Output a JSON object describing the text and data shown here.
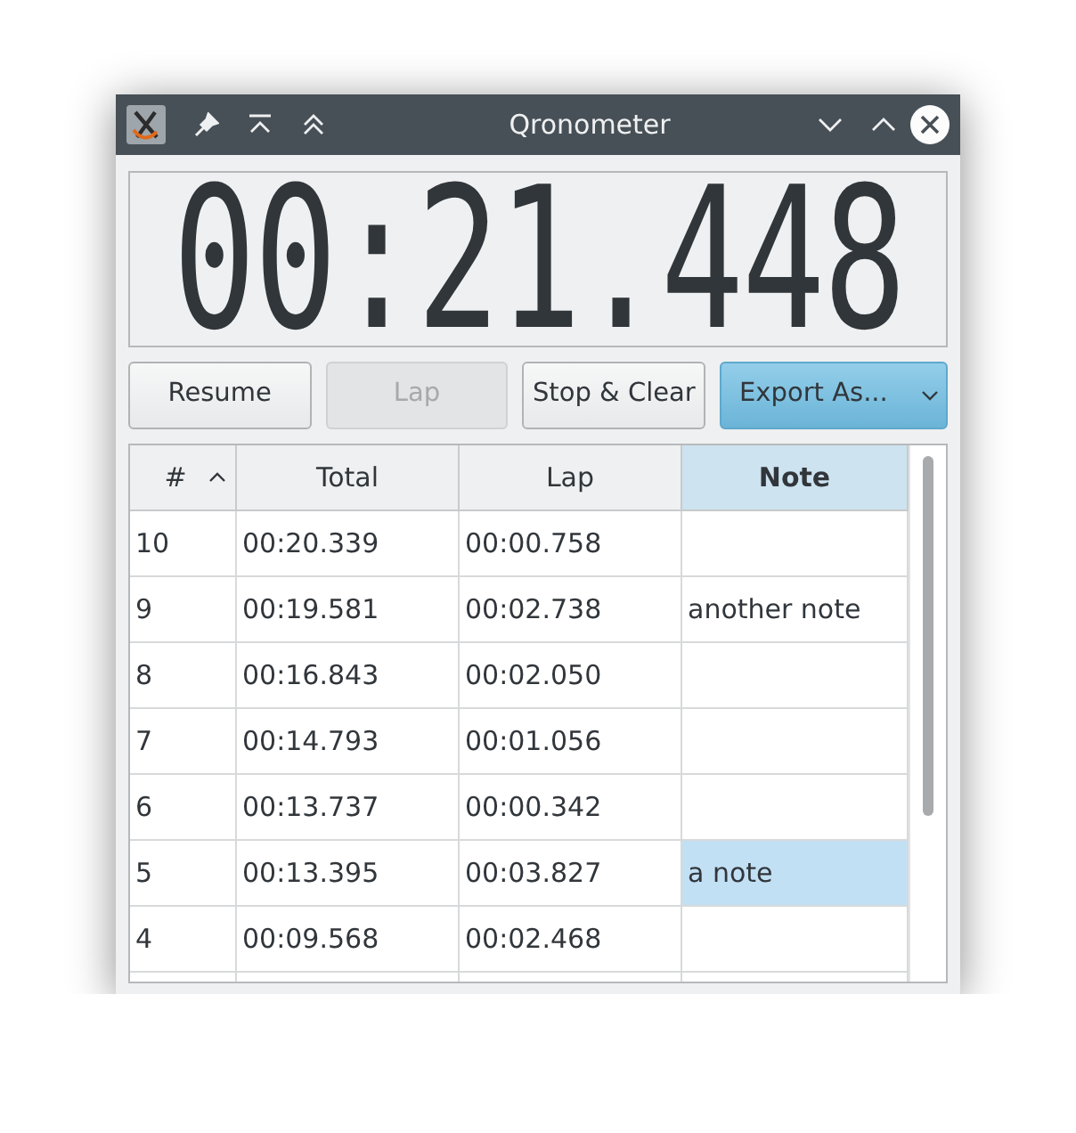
{
  "window": {
    "title": "Qronometer"
  },
  "display": {
    "time": "00:21.448"
  },
  "buttons": [
    {
      "label": "Resume",
      "disabled": false,
      "kind": "push"
    },
    {
      "label": "Lap",
      "disabled": true,
      "kind": "push"
    },
    {
      "label": "Stop & Clear",
      "disabled": false,
      "kind": "push"
    },
    {
      "label": "Export As...",
      "disabled": false,
      "kind": "menu"
    }
  ],
  "table": {
    "columns": [
      {
        "label": "#",
        "sorted_ascending": true,
        "selected": false
      },
      {
        "label": "Total",
        "selected": false
      },
      {
        "label": "Lap",
        "selected": false
      },
      {
        "label": "Note",
        "selected": true
      }
    ],
    "rows": [
      {
        "number": "10",
        "total": "00:20.339",
        "lap": "00:00.758",
        "note_selected": false
      },
      {
        "number": "9",
        "total": "00:19.581",
        "lap": "00:02.738",
        "note": "another note",
        "note_selected": false
      },
      {
        "number": "8",
        "total": "00:16.843",
        "lap": "00:02.050",
        "note_selected": false
      },
      {
        "number": "7",
        "total": "00:14.793",
        "lap": "00:01.056",
        "note_selected": false
      },
      {
        "number": "6",
        "total": "00:13.737",
        "lap": "00:00.342",
        "note_selected": false
      },
      {
        "number": "5",
        "total": "00:13.395",
        "lap": "00:03.827",
        "note": "a note",
        "note_selected": true
      },
      {
        "number": "4",
        "total": "00:09.568",
        "lap": "00:02.468",
        "note_selected": false
      }
    ]
  }
}
